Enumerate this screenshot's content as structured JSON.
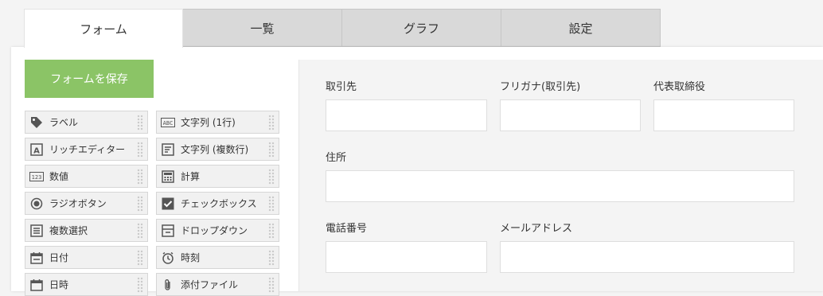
{
  "tabs": [
    {
      "label": "フォーム"
    },
    {
      "label": "一覧"
    },
    {
      "label": "グラフ"
    },
    {
      "label": "設定"
    }
  ],
  "save_button": {
    "label": "フォームを保存"
  },
  "palette": [
    {
      "label": "ラベル",
      "icon": "tag-icon"
    },
    {
      "label": "文字列 (1行)",
      "icon": "abc-icon"
    },
    {
      "label": "リッチエディター",
      "icon": "rich-editor-icon"
    },
    {
      "label": "文字列 (複数行)",
      "icon": "multiline-text-icon"
    },
    {
      "label": "数値",
      "icon": "number-icon"
    },
    {
      "label": "計算",
      "icon": "calculator-icon"
    },
    {
      "label": "ラジオボタン",
      "icon": "radio-button-icon"
    },
    {
      "label": "チェックボックス",
      "icon": "checkbox-icon"
    },
    {
      "label": "複数選択",
      "icon": "multi-select-icon"
    },
    {
      "label": "ドロップダウン",
      "icon": "dropdown-icon"
    },
    {
      "label": "日付",
      "icon": "calendar-icon"
    },
    {
      "label": "時刻",
      "icon": "clock-icon"
    },
    {
      "label": "日時",
      "icon": "datetime-icon"
    },
    {
      "label": "添付ファイル",
      "icon": "paperclip-icon"
    }
  ],
  "form_fields": [
    {
      "label": "取引先",
      "value": ""
    },
    {
      "label": "フリガナ(取引先)",
      "value": ""
    },
    {
      "label": "代表取締役",
      "value": ""
    },
    {
      "label": "住所",
      "value": ""
    },
    {
      "label": "電話番号",
      "value": ""
    },
    {
      "label": "メールアドレス",
      "value": ""
    }
  ],
  "colors": {
    "save_button": "#8bc466",
    "tab_inactive": "#d9d9d9",
    "canvas": "#f4f4f4"
  }
}
